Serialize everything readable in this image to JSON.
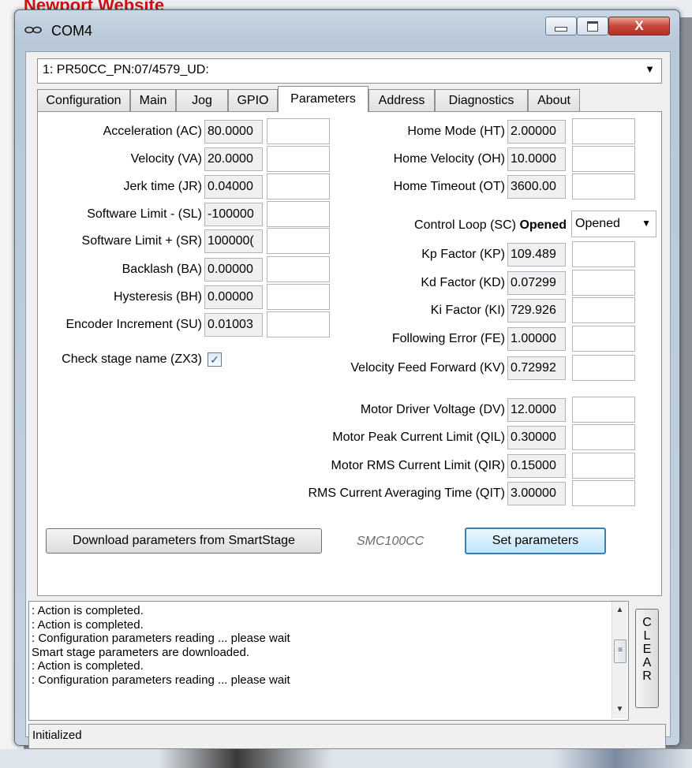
{
  "background": {
    "partial_text": "Newport Website"
  },
  "window": {
    "title": "COM4",
    "close_glyph": "X",
    "device": "1: PR50CC_PN:07/4579_UD:"
  },
  "tabs": [
    {
      "label": "Configuration"
    },
    {
      "label": "Main"
    },
    {
      "label": "Jog"
    },
    {
      "label": "GPIO"
    },
    {
      "label": "Parameters",
      "active": true
    },
    {
      "label": "Address"
    },
    {
      "label": "Diagnostics"
    },
    {
      "label": "About"
    }
  ],
  "left_params": [
    {
      "label": "Acceleration (AC)",
      "value": "80.0000",
      "input": ""
    },
    {
      "label": "Velocity (VA)",
      "value": "20.0000",
      "input": ""
    },
    {
      "label": "Jerk time (JR)",
      "value": "0.04000",
      "input": ""
    },
    {
      "label": "Software Limit - (SL)",
      "value": "-100000",
      "input": ""
    },
    {
      "label": "Software Limit + (SR)",
      "value": "100000(",
      "input": ""
    },
    {
      "label": "Backlash (BA)",
      "value": "0.00000",
      "input": ""
    },
    {
      "label": "Hysteresis (BH)",
      "value": "0.00000",
      "input": ""
    },
    {
      "label": "Encoder Increment (SU)",
      "value": "0.01003",
      "input": ""
    }
  ],
  "check_stage": {
    "label": "Check stage name (ZX3)",
    "checked": true,
    "mark": "✓"
  },
  "home_params": [
    {
      "label": "Home Mode (HT)",
      "value": "2.00000",
      "input": ""
    },
    {
      "label": "Home Velocity (OH)",
      "value": "10.0000",
      "input": ""
    },
    {
      "label": "Home Timeout (OT)",
      "value": "3600.00",
      "input": ""
    }
  ],
  "control_loop": {
    "label": "Control Loop (SC)",
    "state": "Opened",
    "selected": "Opened"
  },
  "pid_params": [
    {
      "label": "Kp Factor (KP)",
      "value": "109.489",
      "input": ""
    },
    {
      "label": "Kd Factor (KD)",
      "value": "0.07299",
      "input": ""
    },
    {
      "label": "Ki Factor (KI)",
      "value": "729.926",
      "input": ""
    },
    {
      "label": "Following Error (FE)",
      "value": "1.00000",
      "input": ""
    },
    {
      "label": "Velocity Feed Forward (KV)",
      "value": "0.72992",
      "input": ""
    }
  ],
  "motor_params": [
    {
      "label": "Motor Driver Voltage (DV)",
      "value": "12.0000",
      "input": ""
    },
    {
      "label": "Motor Peak Current Limit (QIL)",
      "value": "0.30000",
      "input": ""
    },
    {
      "label": "Motor RMS Current Limit (QIR)",
      "value": "0.15000",
      "input": ""
    },
    {
      "label": "RMS Current Averaging Time (QIT)",
      "value": "3.00000",
      "input": ""
    }
  ],
  "buttons": {
    "download": "Download parameters from SmartStage",
    "model": "SMC100CC",
    "set": "Set parameters"
  },
  "log": [
    ": Action is completed.",
    ": Action is completed.",
    ": Configuration parameters reading ... please wait",
    "Smart stage parameters are downloaded.",
    ": Action is completed.",
    ": Configuration parameters reading ... please wait"
  ],
  "clear_button": [
    "C",
    "L",
    "E",
    "A",
    "R"
  ],
  "status": "Initialized"
}
